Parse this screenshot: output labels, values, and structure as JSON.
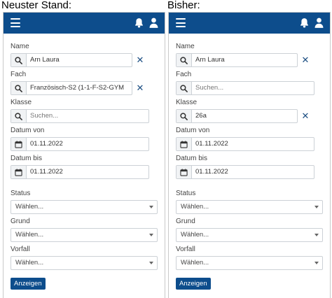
{
  "captions": {
    "left": "Neuster Stand:",
    "right": "Bisher:"
  },
  "colors": {
    "brand": "#0d4d8c",
    "clear": "#1d4f83"
  },
  "panels": [
    {
      "fields": {
        "name": {
          "label": "Name",
          "value": "Arn Laura",
          "placeholder": ""
        },
        "fach": {
          "label": "Fach",
          "value": "Französisch-S2 (1-1-F-S2-GYM",
          "placeholder": ""
        },
        "klasse": {
          "label": "Klasse",
          "value": "",
          "placeholder": "Suchen..."
        },
        "datum_von": {
          "label": "Datum von",
          "value": "01.11.2022"
        },
        "datum_bis": {
          "label": "Datum bis",
          "value": "01.11.2022"
        }
      },
      "selects": {
        "status": {
          "label": "Status",
          "value": "Wählen..."
        },
        "grund": {
          "label": "Grund",
          "value": "Wählen..."
        },
        "vorfall": {
          "label": "Vorfall",
          "value": "Wählen..."
        }
      },
      "submit_label": "Anzeigen"
    },
    {
      "fields": {
        "name": {
          "label": "Name",
          "value": "Arn Laura",
          "placeholder": ""
        },
        "fach": {
          "label": "Fach",
          "value": "",
          "placeholder": "Suchen..."
        },
        "klasse": {
          "label": "Klasse",
          "value": "26a",
          "placeholder": ""
        },
        "datum_von": {
          "label": "Datum von",
          "value": "01.11.2022"
        },
        "datum_bis": {
          "label": "Datum bis",
          "value": "01.11.2022"
        }
      },
      "selects": {
        "status": {
          "label": "Status",
          "value": "Wählen..."
        },
        "grund": {
          "label": "Grund",
          "value": "Wählen..."
        },
        "vorfall": {
          "label": "Vorfall",
          "value": "Wählen..."
        }
      },
      "submit_label": "Anzeigen"
    }
  ]
}
